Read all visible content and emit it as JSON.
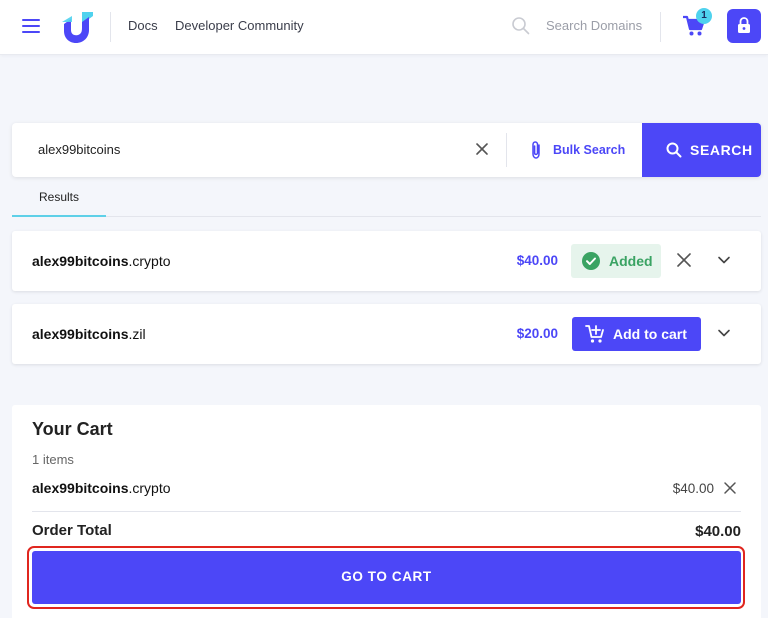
{
  "header": {
    "nav": [
      {
        "label": "Docs"
      },
      {
        "label": "Developer Community"
      }
    ],
    "search_placeholder": "Search Domains",
    "cart_count": "1",
    "icons": [
      "menu-icon",
      "unstoppable-logo",
      "search-icon",
      "cart-icon",
      "lock-icon"
    ]
  },
  "search": {
    "value": "alex99bitcoins",
    "bulk_label": "Bulk Search",
    "button_label": "SEARCH"
  },
  "tabs": {
    "results_label": "Results"
  },
  "results": [
    {
      "name": "alex99bitcoins",
      "ext": ".crypto",
      "price": "$40.00",
      "status": "Added"
    },
    {
      "name": "alex99bitcoins",
      "ext": ".zil",
      "price": "$20.00",
      "action": "Add to cart"
    }
  ],
  "cart": {
    "title": "Your Cart",
    "count_text": "1 items",
    "items": [
      {
        "name": "alex99bitcoins",
        "ext": ".crypto",
        "price": "$40.00"
      }
    ],
    "total_label": "Order Total",
    "total_value": "$40.00",
    "go_to_cart_label": "GO TO CART"
  },
  "colors": {
    "brand": "#4c47f7",
    "added_green": "#3aa363",
    "highlight_red": "#e0261f",
    "tab_accent": "#5ed0e8"
  }
}
